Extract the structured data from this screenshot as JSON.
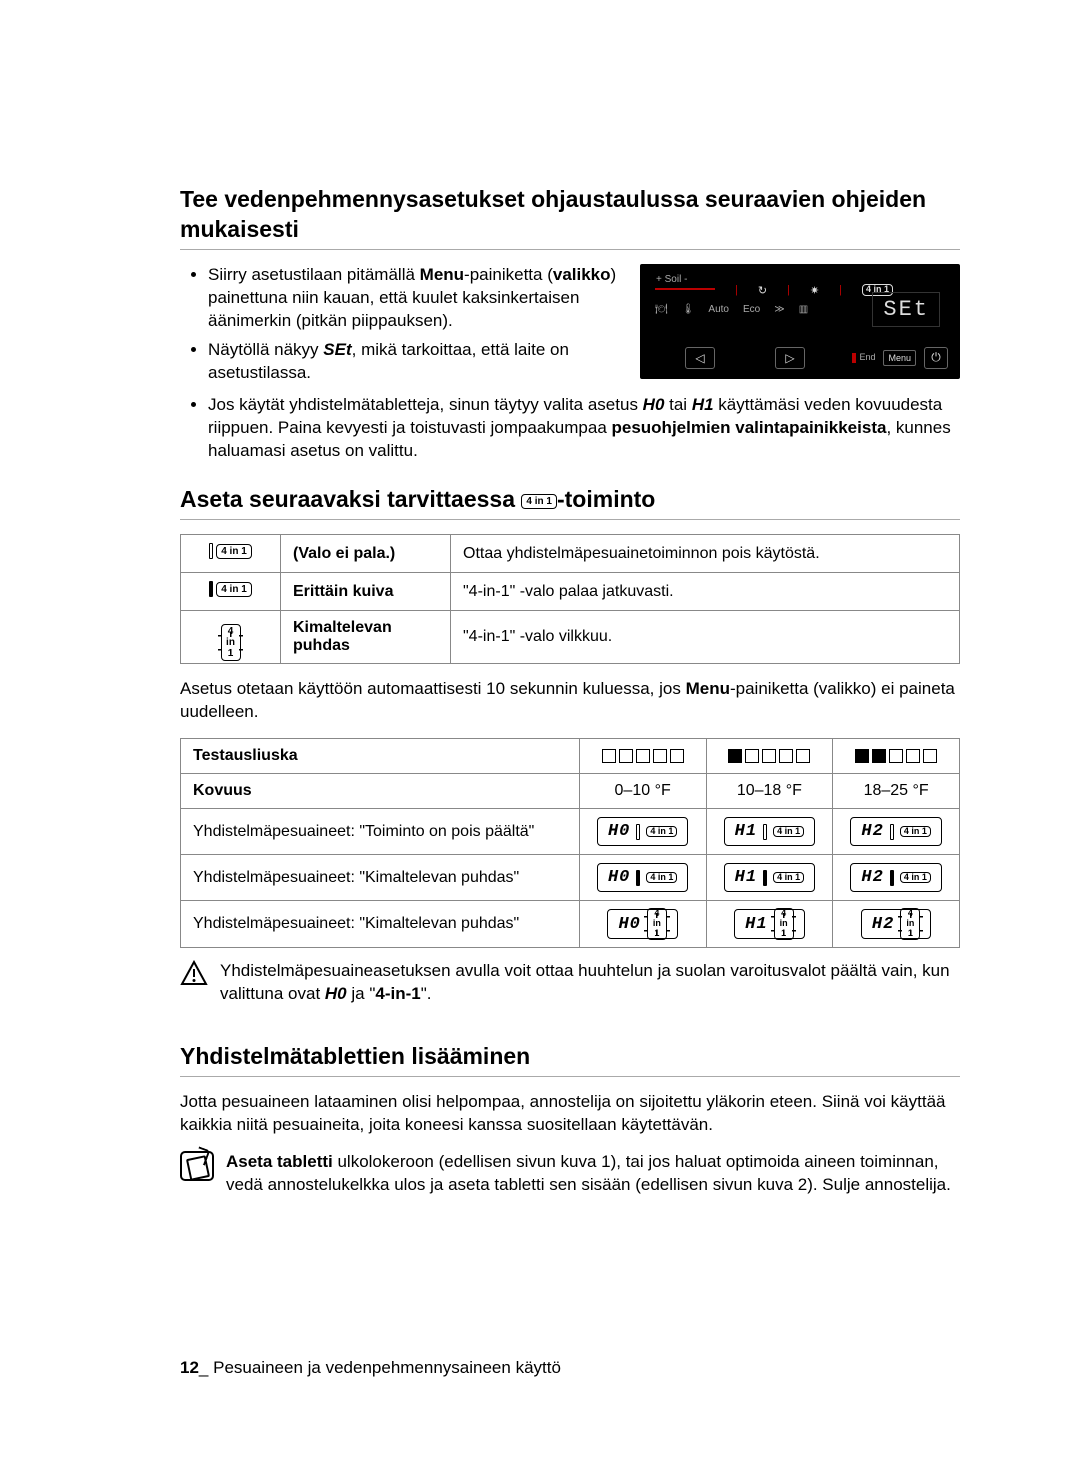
{
  "section1": {
    "title": "Tee vedenpehmennysasetukset ohjaustaulussa seuraavien ohjeiden mukaisesti",
    "bullets": {
      "b1_pre": "Siirry asetustilaan pitämällä ",
      "b1_bold1": "Menu",
      "b1_mid": "-painiketta (",
      "b1_bold2": "valikko",
      "b1_post": ") painettuna niin kauan, että kuulet kaksinkertaisen äänimerkin (pitkän piippauksen).",
      "b2_pre": "Näytöllä näkyy ",
      "b2_em": "SEt",
      "b2_post": ", mikä tarkoittaa, että laite on asetustilassa.",
      "b3_pre": "Jos käytät yhdistelmätabletteja, sinun täytyy valita asetus ",
      "b3_h0": "H0",
      "b3_mid1": " tai ",
      "b3_h1": "H1",
      "b3_mid2": " käyttämäsi veden kovuudesta riippuen. Paina kevyesti ja toistuvasti jompaakumpaa ",
      "b3_bold": "pesuohjelmien valintapainikkeista",
      "b3_post": ", kunnes haluamasi asetus on valittu."
    },
    "panel": {
      "soil": "+  Soil  -",
      "auto": "Auto",
      "eco": "Eco",
      "arrows": "≫",
      "display": "SEt",
      "left": "◁",
      "right": "▷",
      "end": "End",
      "menu": "Menu",
      "power": "⏻"
    }
  },
  "section2": {
    "title_pre": "Aseta seuraavaksi tarvittaessa ",
    "title_post": "-toiminto",
    "badge": "4 in 1",
    "rows": [
      {
        "label": "(Valo ei pala.)",
        "desc": "Ottaa yhdistelmäpesuainetoiminnon pois käytöstä."
      },
      {
        "label": "Erittäin kuiva",
        "desc": "\"4-in-1\" -valo palaa jatkuvasti."
      },
      {
        "label": "Kimaltelevan puhdas",
        "desc": "\"4-in-1\" -valo vilkkuu."
      }
    ],
    "after_para_pre": "Asetus otetaan käyttöön automaattisesti 10 sekunnin kuluessa, jos ",
    "after_para_bold": "Menu",
    "after_para_post": "-painiketta (valikko) ei paineta uudelleen."
  },
  "table2": {
    "h_test": "Testausliuska",
    "h_hard": "Kovuus",
    "hard_vals": [
      "0–10 °F",
      "10–18 °F",
      "18–25 °F"
    ],
    "row_a": "Yhdistelmäpesuaineet: \"Toiminto on pois päältä\"",
    "row_b": "Yhdistelmäpesuaineet: \"Kimaltelevan puhdas\"",
    "row_c": "Yhdistelmäpesuaineet: \"Kimaltelevan puhdas\"",
    "codes": [
      "H0",
      "H1",
      "H2"
    ]
  },
  "info1_pre": "Yhdistelmäpesuaineasetuksen avulla voit ottaa huuhtelun ja suolan varoitusvalot päältä vain, kun valittuna ovat ",
  "info1_h0": "H0",
  "info1_mid": " ja \"",
  "info1_bold": "4-in-1",
  "info1_post": "\".",
  "section3": {
    "title": "Yhdistelmätablettien lisääminen",
    "para": "Jotta pesuaineen lataaminen olisi helpompaa, annostelija on sijoitettu yläkorin eteen. Siinä voi käyttää kaikkia niitä pesuaineita, joita koneesi kanssa suositellaan käytettävän.",
    "note_bold": "Aseta tabletti",
    "note_text_a": " ulkolokeroon (edellisen sivun ",
    "note_kuva1": "kuva 1",
    "note_text_b": "), tai jos haluat optimoida aineen toiminnan, vedä annostelukelkka ulos ja aseta tabletti sen sisään (edellisen sivun ",
    "note_kuva2": "kuva 2",
    "note_text_c": "). Sulje annostelija."
  },
  "footer": {
    "num": "12",
    "sep": "_ ",
    "text": "Pesuaineen ja vedenpehmennysaineen käyttö"
  }
}
